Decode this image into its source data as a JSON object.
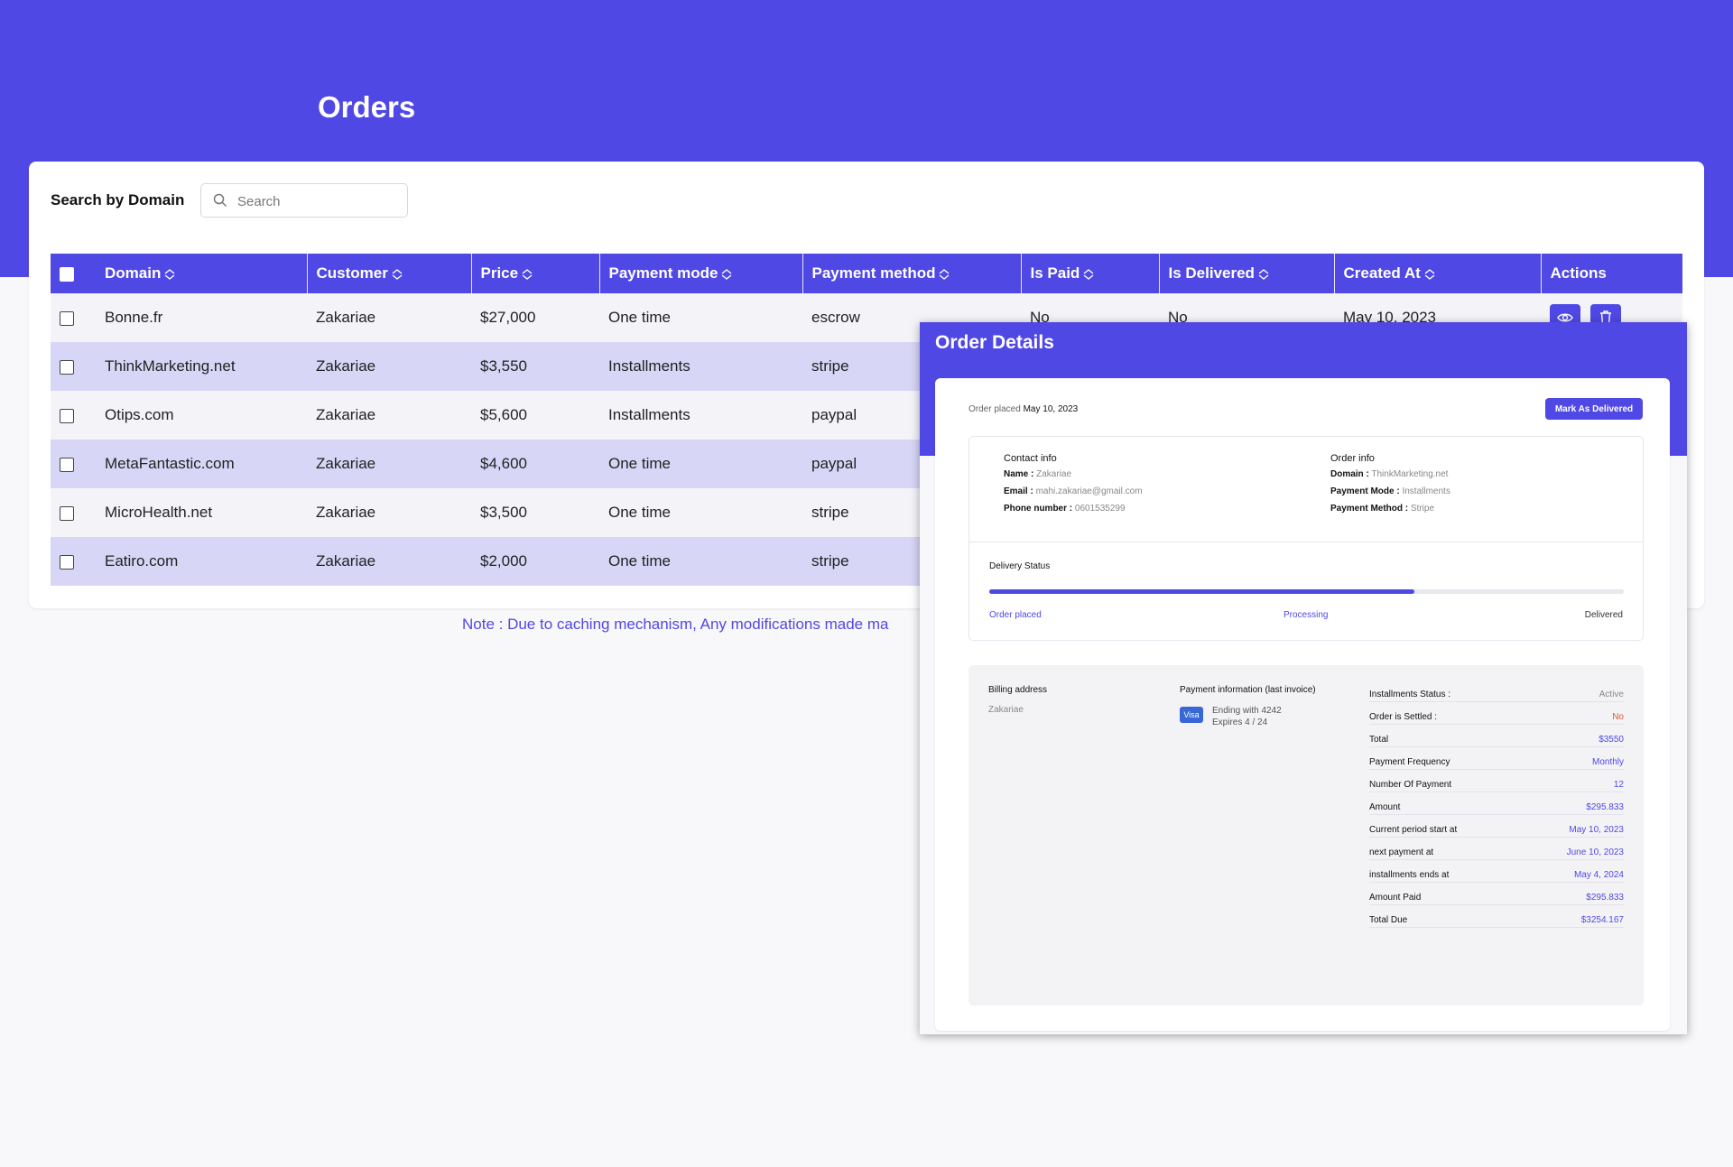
{
  "page": {
    "title": "Orders"
  },
  "search": {
    "label": "Search by Domain",
    "placeholder": "Search"
  },
  "table": {
    "columns": [
      "Domain",
      "Customer",
      "Price",
      "Payment mode",
      "Payment method",
      "Is Paid",
      "Is Delivered",
      "Created At",
      "Actions"
    ],
    "rows": [
      {
        "domain": "Bonne.fr",
        "customer": "Zakariae",
        "price": "$27,000",
        "mode": "One time",
        "method": "escrow",
        "paid": "No",
        "delivered": "No",
        "created": "May 10, 2023"
      },
      {
        "domain": "ThinkMarketing.net",
        "customer": "Zakariae",
        "price": "$3,550",
        "mode": "Installments",
        "method": "stripe"
      },
      {
        "domain": "Otips.com",
        "customer": "Zakariae",
        "price": "$5,600",
        "mode": "Installments",
        "method": "paypal"
      },
      {
        "domain": "MetaFantastic.com",
        "customer": "Zakariae",
        "price": "$4,600",
        "mode": "One time",
        "method": "paypal"
      },
      {
        "domain": "MicroHealth.net",
        "customer": "Zakariae",
        "price": "$3,500",
        "mode": "One time",
        "method": "stripe"
      },
      {
        "domain": "Eatiro.com",
        "customer": "Zakariae",
        "price": "$2,000",
        "mode": "One time",
        "method": "stripe"
      }
    ]
  },
  "note": "Note : Due to caching mechanism, Any modifications made ma",
  "modal": {
    "title": "Order Details",
    "placed_label": "Order placed",
    "placed_date": "May 10, 2023",
    "mark_button": "Mark As Delivered",
    "contact": {
      "title": "Contact info",
      "name_label": "Name :",
      "name": "Zakariae",
      "email_label": "Email :",
      "email": "mahi.zakariae@gmail.com",
      "phone_label": "Phone number :",
      "phone": "0601535299"
    },
    "order_info": {
      "title": "Order info",
      "domain_label": "Domain :",
      "domain": "ThinkMarketing.net",
      "mode_label": "Payment Mode :",
      "mode": "Installments",
      "method_label": "Payment Method :",
      "method": "Stripe"
    },
    "delivery": {
      "title": "Delivery Status",
      "progress": 0.67,
      "steps": [
        "Order placed",
        "Processing",
        "Delivered"
      ]
    },
    "billing": {
      "title": "Billing address",
      "name": "Zakariae"
    },
    "payment": {
      "title": "Payment information (last invoice)",
      "brand": "Visa",
      "ending": "Ending with 4242",
      "expires": "Expires 4 / 24"
    },
    "installments": [
      {
        "label": "Installments Status :",
        "value": "Active",
        "color": "#888888"
      },
      {
        "label": "Order is Settled :",
        "value": "No",
        "color": "#e05a2a"
      },
      {
        "label": "Total",
        "value": "$3550"
      },
      {
        "label": "Payment Frequency",
        "value": "Monthly"
      },
      {
        "label": "Number Of Payment",
        "value": "12"
      },
      {
        "label": "Amount",
        "value": "$295.833"
      },
      {
        "label": "Current period start at",
        "value": "May 10, 2023"
      },
      {
        "label": "next payment at",
        "value": "June 10, 2023"
      },
      {
        "label": "installments ends at",
        "value": "May 4, 2024"
      },
      {
        "label": "Amount Paid",
        "value": "$295.833"
      },
      {
        "label": "Total Due",
        "value": "$3254.167"
      }
    ]
  },
  "colors": {
    "accent": "#5048e5",
    "row_alt": "#d8d6f6",
    "row": "#f4f4f8",
    "danger": "#e05a2a"
  },
  "icons": {
    "search": "search-icon",
    "sort": "sort-icon",
    "view": "eye-icon",
    "delete": "trash-icon"
  }
}
